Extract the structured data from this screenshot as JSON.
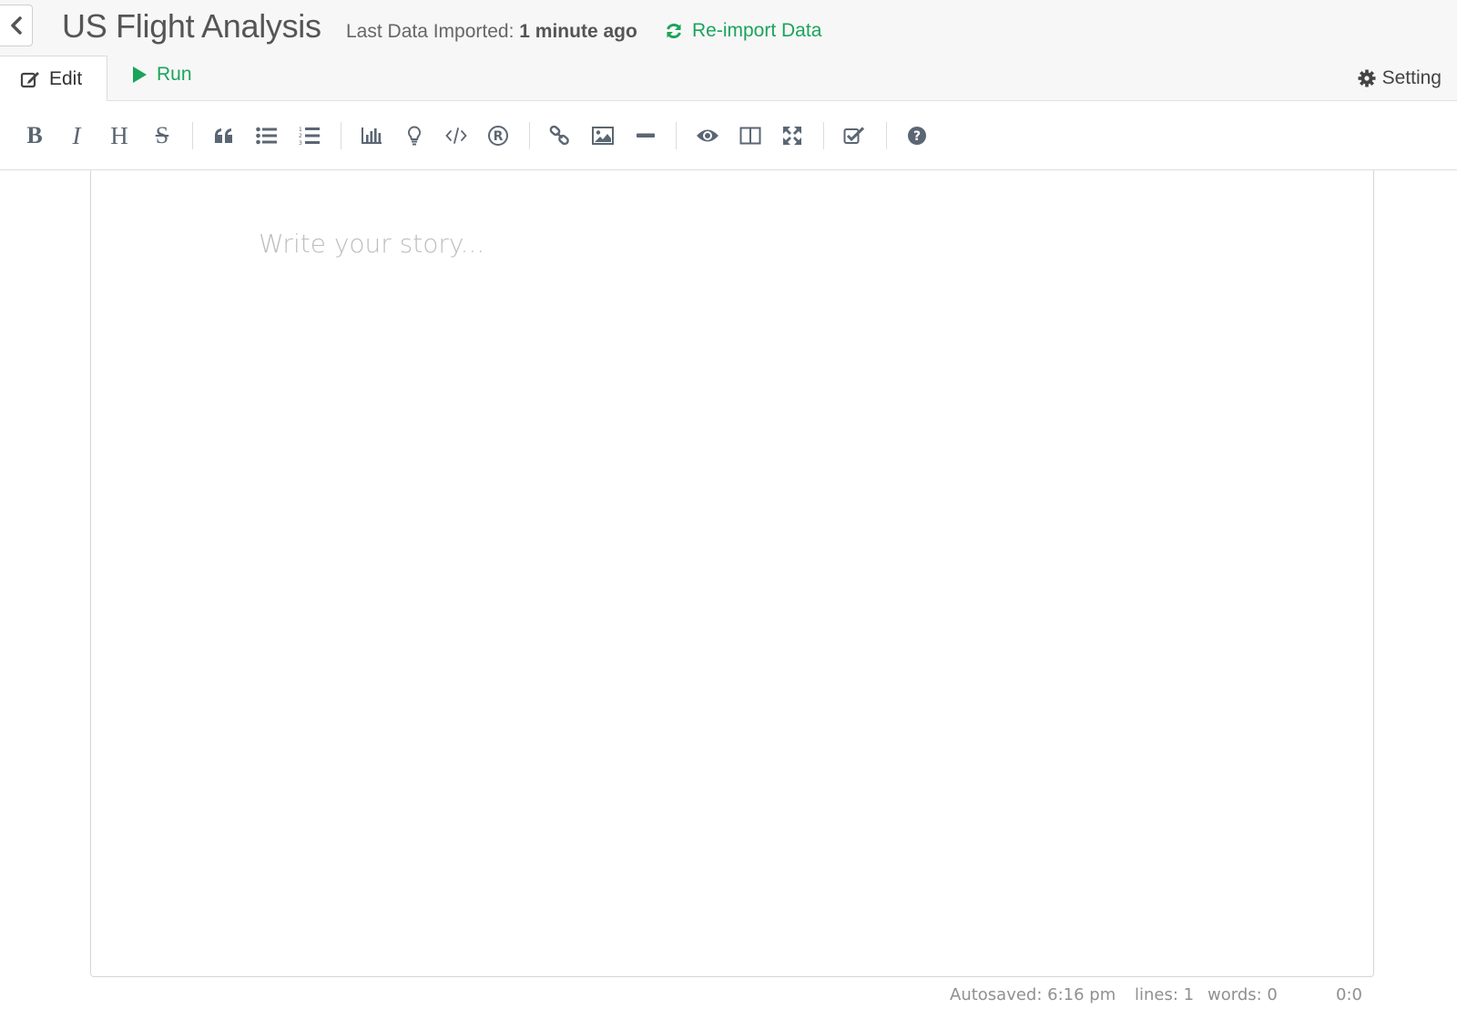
{
  "header": {
    "title": "US Flight Analysis",
    "import_label": "Last Data Imported:",
    "import_value": "1 minute ago",
    "reimport_label": "Re-import Data"
  },
  "tabs": {
    "edit_label": "Edit",
    "run_label": "Run",
    "setting_label": "Setting"
  },
  "toolbar": {
    "icons": [
      "bold-icon",
      "italic-icon",
      "heading-icon",
      "strikethrough-icon",
      "quote-icon",
      "unordered-list-icon",
      "ordered-list-icon",
      "chart-icon",
      "lightbulb-icon",
      "code-icon",
      "registered-icon",
      "link-icon",
      "image-icon",
      "horizontal-rule-icon",
      "preview-eye-icon",
      "side-by-side-icon",
      "fullscreen-icon",
      "checkbox-icon",
      "help-icon"
    ],
    "bold": "B",
    "italic": "I",
    "heading": "H",
    "strike": "S"
  },
  "editor": {
    "placeholder": "Write your story..."
  },
  "status": {
    "autosaved": "Autosaved: 6:16 pm",
    "lines": "lines: 1",
    "words": "words: 0",
    "cursor": "0:0"
  },
  "colors": {
    "accent_green": "#1aa45b",
    "icon_gray": "#5b6673",
    "header_bg": "#f7f7f7"
  }
}
